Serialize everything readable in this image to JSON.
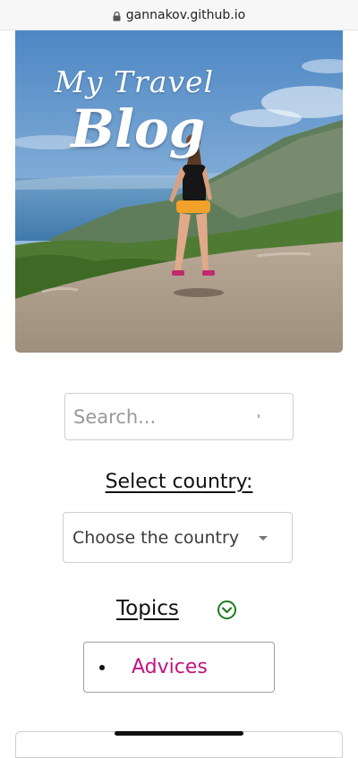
{
  "browser": {
    "url": "gannakov.github.io"
  },
  "hero": {
    "title_line1": "My Travel",
    "title_line2": "Blog"
  },
  "search": {
    "placeholder": "Search..."
  },
  "country_filter": {
    "label": "Select country:",
    "selected": "Choose the country"
  },
  "topics": {
    "label": "Topics",
    "items": [
      {
        "label": "Advices"
      }
    ]
  },
  "colors": {
    "link": "#c0147f",
    "toggle_icon": "#1f7a1f"
  },
  "icons": {
    "lock": "lock-icon",
    "toggle": "chevron-down-circle-icon",
    "select_caret": "caret-down-icon"
  }
}
